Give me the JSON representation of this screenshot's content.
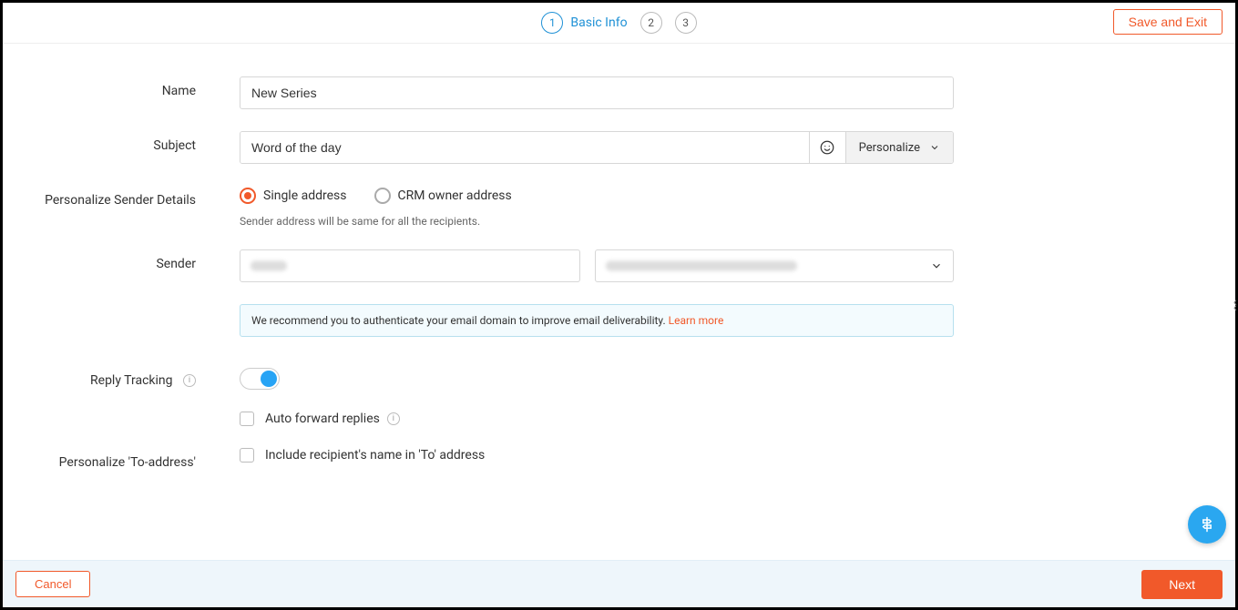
{
  "header": {
    "steps": [
      {
        "num": "1",
        "label": "Basic Info",
        "active": true
      },
      {
        "num": "2",
        "label": "",
        "active": false
      },
      {
        "num": "3",
        "label": "",
        "active": false
      }
    ],
    "save_exit": "Save and Exit"
  },
  "form": {
    "name": {
      "label": "Name",
      "value": "New Series"
    },
    "subject": {
      "label": "Subject",
      "value": "Word of the day",
      "personalize_label": "Personalize"
    },
    "sender_details": {
      "label": "Personalize Sender Details",
      "options": [
        {
          "id": "single",
          "label": "Single address",
          "selected": true
        },
        {
          "id": "crm",
          "label": "CRM owner address",
          "selected": false
        }
      ],
      "helper": "Sender address will be same for all the recipients."
    },
    "sender": {
      "label": "Sender",
      "name_value": "",
      "email_value": ""
    },
    "banner": {
      "text": "We recommend you to authenticate your email domain to improve email deliverability. ",
      "link": "Learn more"
    },
    "reply_tracking": {
      "label": "Reply Tracking",
      "enabled": true
    },
    "auto_forward": {
      "label": "Auto forward replies",
      "checked": false
    },
    "to_address": {
      "label": "Personalize 'To-address'",
      "checkbox_label": "Include recipient's name in 'To' address",
      "checked": false
    }
  },
  "footer": {
    "cancel": "Cancel",
    "next": "Next"
  }
}
